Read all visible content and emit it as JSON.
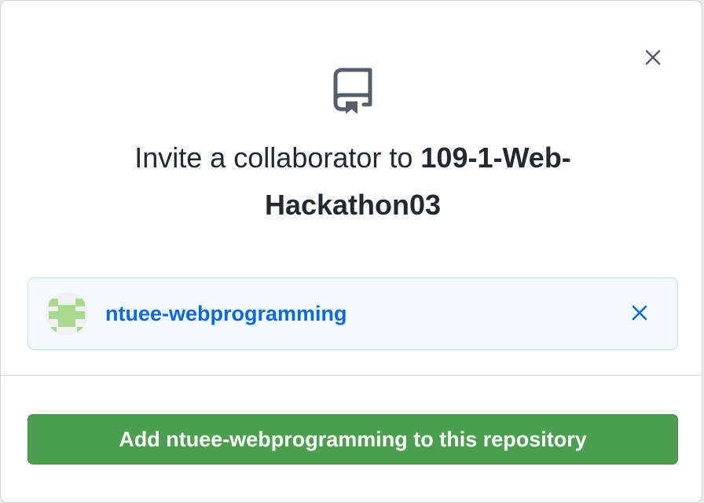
{
  "dialog": {
    "title_prefix": "Invite a collaborator to ",
    "title_repo_line1": "109-1-Web-",
    "title_repo_line2": "Hackathon03",
    "close_icon": "close-icon",
    "repo_icon": "repo-icon"
  },
  "selected_user": {
    "username": "ntuee-webprogramming",
    "avatar_icon": "identicon-avatar",
    "remove_icon": "close-icon"
  },
  "actions": {
    "add_button_label": "Add ntuee-webprogramming to this repository"
  },
  "colors": {
    "link": "#0969da",
    "primary_button": "#4c9f4f",
    "selected_bg": "#f1f8ff",
    "text": "#24292f"
  }
}
